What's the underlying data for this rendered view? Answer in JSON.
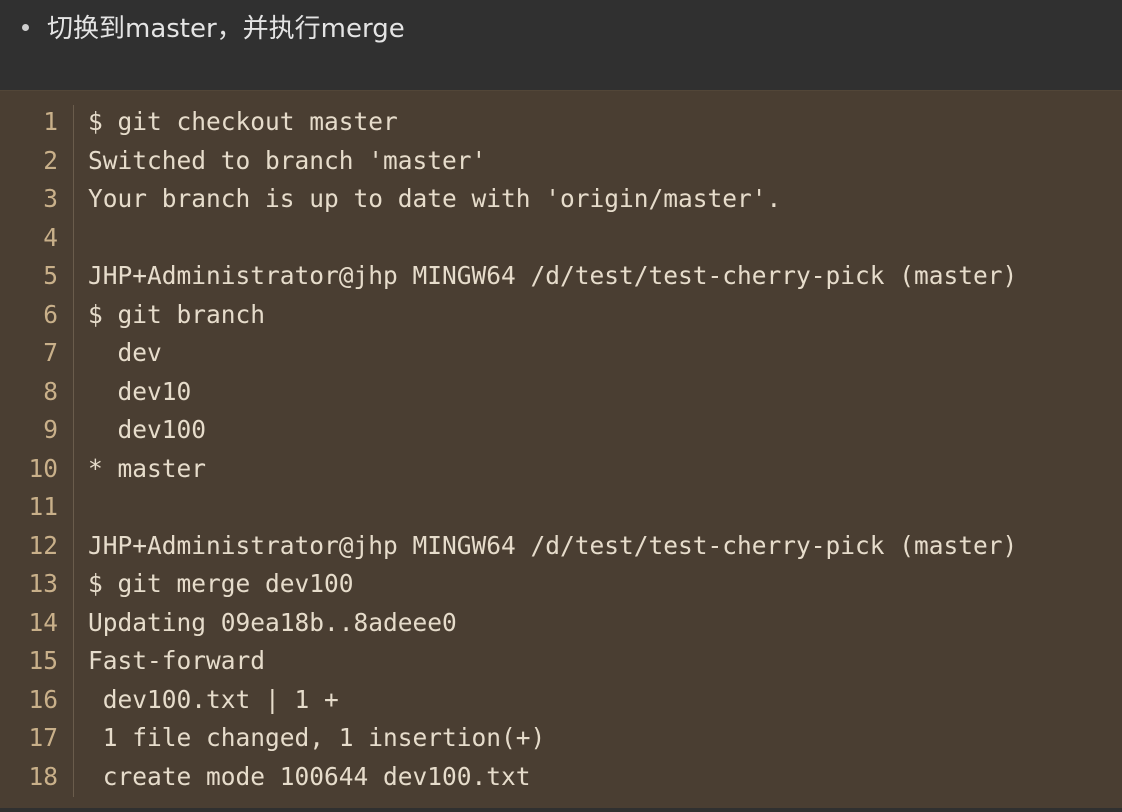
{
  "instruction": {
    "text": "切换到master，并执行merge"
  },
  "code": {
    "lines": [
      {
        "num": "1",
        "text": "$ git checkout master"
      },
      {
        "num": "2",
        "text": "Switched to branch 'master'"
      },
      {
        "num": "3",
        "text": "Your branch is up to date with 'origin/master'."
      },
      {
        "num": "4",
        "text": ""
      },
      {
        "num": "5",
        "text": "JHP+Administrator@jhp MINGW64 /d/test/test-cherry-pick (master)"
      },
      {
        "num": "6",
        "text": "$ git branch"
      },
      {
        "num": "7",
        "text": "  dev"
      },
      {
        "num": "8",
        "text": "  dev10"
      },
      {
        "num": "9",
        "text": "  dev100"
      },
      {
        "num": "10",
        "text": "* master"
      },
      {
        "num": "11",
        "text": ""
      },
      {
        "num": "12",
        "text": "JHP+Administrator@jhp MINGW64 /d/test/test-cherry-pick (master)"
      },
      {
        "num": "13",
        "text": "$ git merge dev100"
      },
      {
        "num": "14",
        "text": "Updating 09ea18b..8adeee0"
      },
      {
        "num": "15",
        "text": "Fast-forward"
      },
      {
        "num": "16",
        "text": " dev100.txt | 1 +"
      },
      {
        "num": "17",
        "text": " 1 file changed, 1 insertion(+)"
      },
      {
        "num": "18",
        "text": " create mode 100644 dev100.txt"
      }
    ]
  },
  "colors": {
    "page_bg": "#303030",
    "code_bg": "#4a3e32",
    "line_number": "#c9b08a",
    "code_text": "#e6dccb"
  }
}
